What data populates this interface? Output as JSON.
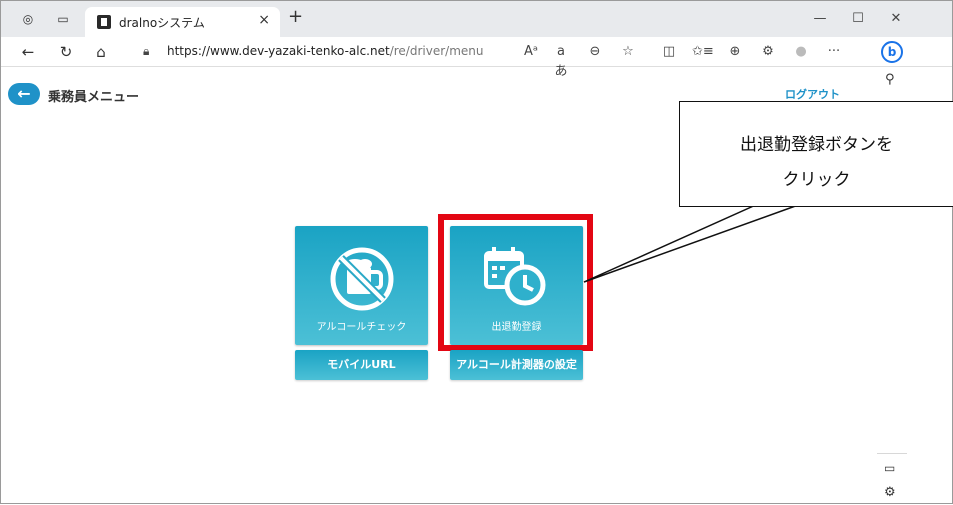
{
  "browser": {
    "tab_title": "dralnoシステム",
    "tab_close": "×",
    "new_tab": "+",
    "window": {
      "minimize": "—",
      "maximize": "☐",
      "close": "✕"
    },
    "nav": {
      "back": "←",
      "refresh": "↻",
      "home": "⌂"
    },
    "url_host": "https://www.dev-yazaki-tenko-alc.net",
    "url_path": "/re/driver/menu",
    "tools": {
      "read_aloud": "Aᵃ",
      "translate": "aあ",
      "zoom": "⊖",
      "favorite": "☆",
      "split": "◫",
      "favorites": "✩≡",
      "collections": "⊕",
      "extensions": "⚙",
      "profile": "●",
      "more": "···",
      "bing": "b"
    },
    "sidebar": {
      "search": "🔍",
      "panel": "▭",
      "settings": "⚙"
    }
  },
  "page": {
    "back_icon": "arrow-left",
    "title": "乗務員メニュー",
    "logout": "ログアウト",
    "tiles": [
      {
        "label": "アルコールチェック",
        "icon": "no-drinking-icon"
      },
      {
        "label": "出退勤登録",
        "icon": "calendar-clock-icon"
      }
    ],
    "buttons": [
      {
        "label": "モバイルURL"
      },
      {
        "label": "アルコール計測器の設定"
      }
    ]
  },
  "callout": {
    "line1": "出退勤登録ボタンを",
    "line2": "クリック"
  },
  "colors": {
    "accent": "#1f92c8",
    "tile": "#1aa3c4",
    "highlight": "#e30613"
  }
}
